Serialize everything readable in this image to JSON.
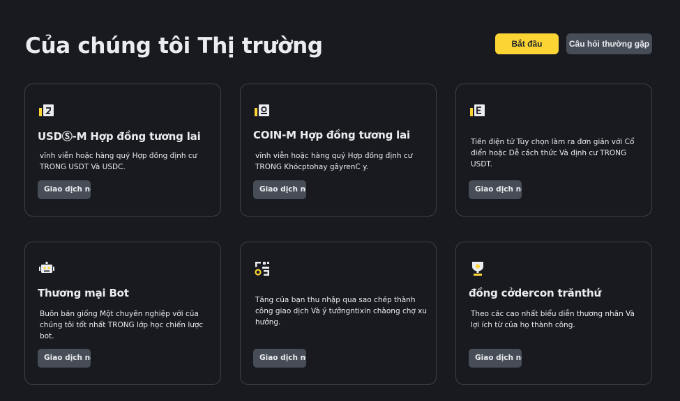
{
  "header": {
    "title": "Của chúng tôi Thị trường",
    "start_label": "Bắt đầu",
    "faq_label": "Câu hỏi thường gặp"
  },
  "colors": {
    "background": "#181a20",
    "accent": "#fcd535",
    "secondary_button": "#474d57",
    "card_border": "#3c4048"
  },
  "cards": [
    {
      "icon": "usds-m-futures-icon",
      "title": "USDⓈ-M Hợp đồng tương lai",
      "description": "vĩnh viễn hoặc hàng quý Hợp đồng định cư TRONG USDT Và USDC.",
      "button": "Giao dịch ngay"
    },
    {
      "icon": "coin-m-futures-icon",
      "title": "COIN-M Hợp đồng tương lai",
      "description": "vĩnh viễn hoặc hàng quý Hợp đồng định cư TRONG Khócptohay gâyrenC y.",
      "button": "Giao dịch ngay"
    },
    {
      "icon": "options-icon",
      "title": "",
      "description": "Tiền điện tử Tùy chọn làm ra đơn giản với Cổ điển hoặc Dễ cách thức Và định cư TRONG USDT.",
      "button": "Giao dịch ngay"
    },
    {
      "icon": "trading-bot-icon",
      "title": "Thương mại Bot",
      "description": "Buôn bán giống Một chuyên nghiệp với của chúng tôi tốt nhất TRONG lớp học chiến lược bot.",
      "button": "Giao dịch ngay"
    },
    {
      "icon": "copy-trading-icon",
      "title": "",
      "description": "Tăng của bạn thu nhập qua sao chép thành công giao dịch Và ý tưởngntixin chàong chợ xu hướng.",
      "button": "Giao dịch ngay"
    },
    {
      "icon": "trophy-icon",
      "title": "đồng cởdercon trănthứ",
      "description": "Theo các cao nhất biểu diễn thương nhân Và lợi ích từ của họ thành công.",
      "button": "Giao dịch ngay"
    }
  ]
}
